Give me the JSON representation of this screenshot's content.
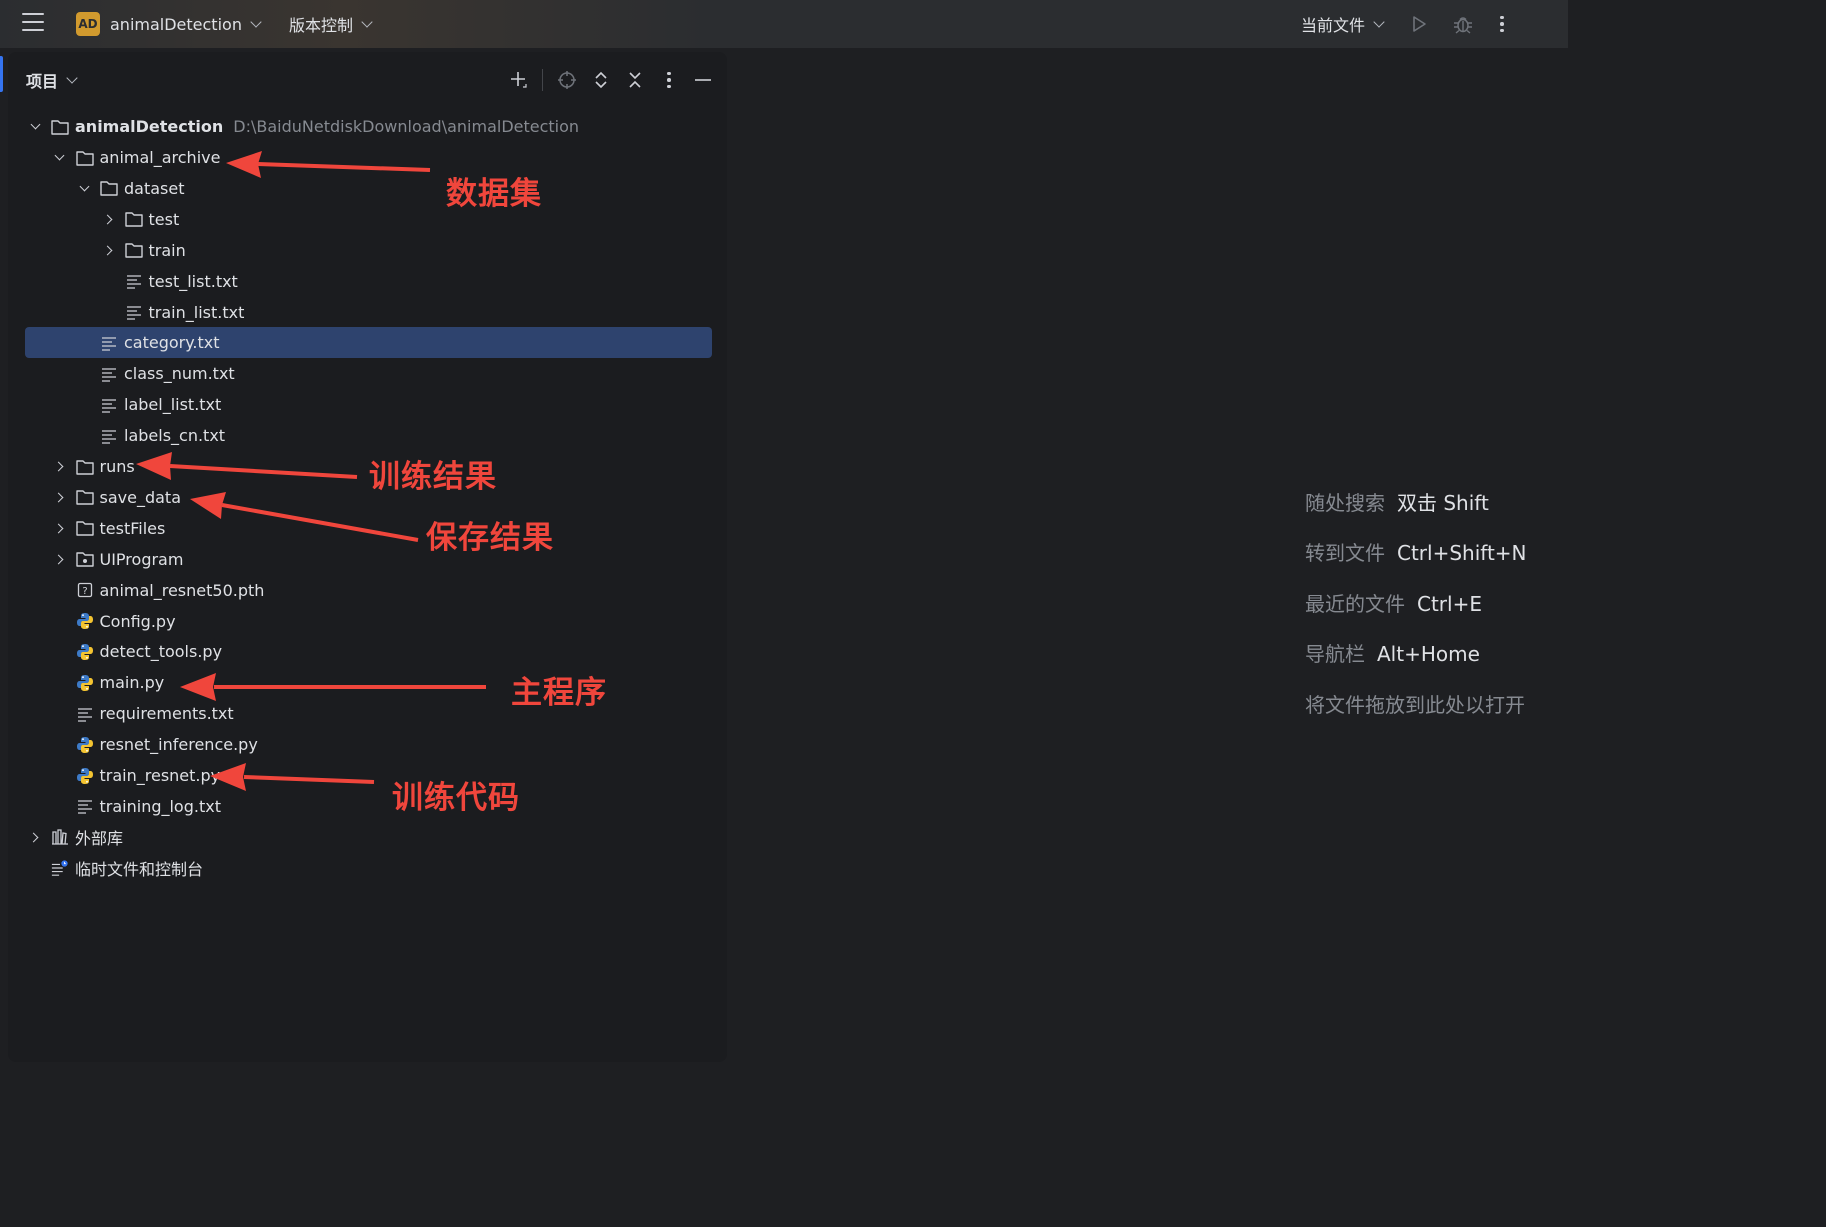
{
  "titlebar": {
    "project_badge": "AD",
    "project_name": "animalDetection",
    "vcs_label": "版本控制",
    "run_config": "当前文件"
  },
  "panel": {
    "title": "项目"
  },
  "tree": {
    "root": {
      "label": "animalDetection",
      "path": "D:\\BaiduNetdiskDownload\\animalDetection"
    },
    "items": [
      {
        "label": "animal_archive",
        "icon": "folder-icon"
      },
      {
        "label": "dataset",
        "icon": "folder-icon"
      },
      {
        "label": "test",
        "icon": "folder-icon"
      },
      {
        "label": "train",
        "icon": "folder-icon"
      },
      {
        "label": "test_list.txt",
        "icon": "text-file-icon"
      },
      {
        "label": "train_list.txt",
        "icon": "text-file-icon"
      },
      {
        "label": "category.txt",
        "icon": "text-file-icon"
      },
      {
        "label": "class_num.txt",
        "icon": "text-file-icon"
      },
      {
        "label": "label_list.txt",
        "icon": "text-file-icon"
      },
      {
        "label": "labels_cn.txt",
        "icon": "text-file-icon"
      },
      {
        "label": "runs",
        "icon": "folder-icon"
      },
      {
        "label": "save_data",
        "icon": "folder-icon"
      },
      {
        "label": "testFiles",
        "icon": "folder-icon"
      },
      {
        "label": "UIProgram",
        "icon": "module-folder-icon"
      },
      {
        "label": "animal_resnet50.pth",
        "icon": "unknown-file-icon"
      },
      {
        "label": "Config.py",
        "icon": "python-icon"
      },
      {
        "label": "detect_tools.py",
        "icon": "python-icon"
      },
      {
        "label": "main.py",
        "icon": "python-icon"
      },
      {
        "label": "requirements.txt",
        "icon": "text-file-icon"
      },
      {
        "label": "resnet_inference.py",
        "icon": "python-icon"
      },
      {
        "label": "train_resnet.py",
        "icon": "python-icon"
      },
      {
        "label": "training_log.txt",
        "icon": "text-file-icon"
      },
      {
        "label": "外部库",
        "icon": "library-icon"
      },
      {
        "label": "临时文件和控制台",
        "icon": "scratches-icon"
      }
    ],
    "selected": "category.txt"
  },
  "annotations": {
    "dataset": "数据集",
    "train_results": "训练结果",
    "save_results": "保存结果",
    "main_program": "主程序",
    "train_code": "训练代码"
  },
  "editor_hints": [
    {
      "label": "随处搜索",
      "key": "双击 Shift"
    },
    {
      "label": "转到文件",
      "key": "Ctrl+Shift+N"
    },
    {
      "label": "最近的文件",
      "key": "Ctrl+E"
    },
    {
      "label": "导航栏",
      "key": "Alt+Home"
    },
    {
      "label": "将文件拖放到此处以打开",
      "key": ""
    }
  ],
  "colors": {
    "accent": "#3574f0",
    "selection": "#2e436e",
    "annotation": "#f0463c",
    "project_badge": "#d19a2e"
  }
}
